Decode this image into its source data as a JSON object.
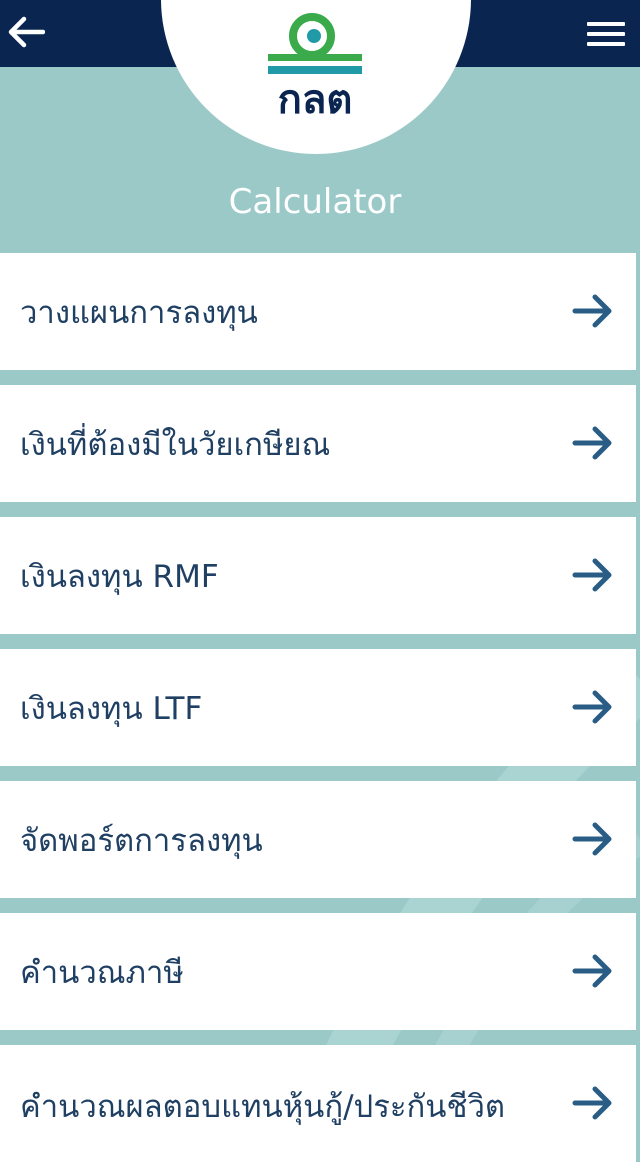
{
  "header": {
    "back_icon": "arrow-left-icon",
    "menu_icon": "hamburger-icon",
    "logo_text": "กลต",
    "title": "Calculator"
  },
  "colors": {
    "topbar": "#0a2550",
    "background": "#9ac9c8",
    "item_text": "#1f3f63",
    "arrow": "#2a5d86",
    "logo_green": "#3aaa4a",
    "logo_teal": "#1f9aa6"
  },
  "menu": {
    "items": [
      {
        "label": "วางแผนการลงทุน",
        "icon": "arrow-right-icon"
      },
      {
        "label": "เงินที่ต้องมีในวัยเกษียณ",
        "icon": "arrow-right-icon"
      },
      {
        "label": "เงินลงทุน RMF",
        "icon": "arrow-right-icon"
      },
      {
        "label": "เงินลงทุน LTF",
        "icon": "arrow-right-icon"
      },
      {
        "label": "จัดพอร์ตการลงทุน",
        "icon": "arrow-right-icon"
      },
      {
        "label": "คำนวณภาษี",
        "icon": "arrow-right-icon"
      },
      {
        "label": "คำนวณผลตอบแทนหุ้นกู้/ประกันชีวิต",
        "icon": "arrow-right-icon"
      }
    ]
  }
}
